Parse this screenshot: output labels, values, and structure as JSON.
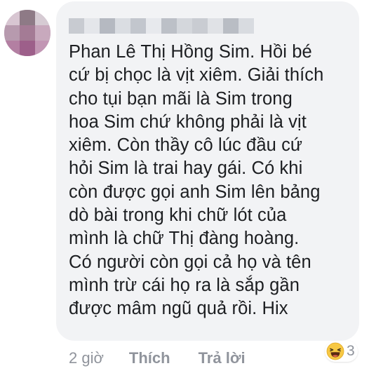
{
  "comment": {
    "lines": [
      "Phan Lê Thị Hồng Sim. Hồi bé",
      "cứ bị chọc là vịt xiêm. Giải thích",
      "cho tụi bạn mãi là Sim trong",
      "hoa Sim chứ không phải là vịt",
      "xiêm. Còn thầy cô lúc đầu cứ",
      "hỏi Sim là trai hay gái. Có khi",
      "còn được gọi anh Sim lên bảng",
      "dò bài trong khi chữ lót của",
      "mình là chữ Thị đàng hoàng.",
      "Có người còn gọi cả họ và tên",
      "mình trừ cái họ ra là sắp gần",
      "được mâm ngũ quả rồi. Hix"
    ]
  },
  "actions": {
    "timestamp": "2 giờ",
    "like_label": "Thích",
    "reply_label": "Trả lời"
  },
  "reactions": {
    "icon": "haha-emoji",
    "count": "3"
  },
  "colors": {
    "bubble_bg": "#f2f3f5",
    "text": "#1c1e21",
    "meta": "#90949c",
    "emoji_yellow": "#f7c843"
  }
}
